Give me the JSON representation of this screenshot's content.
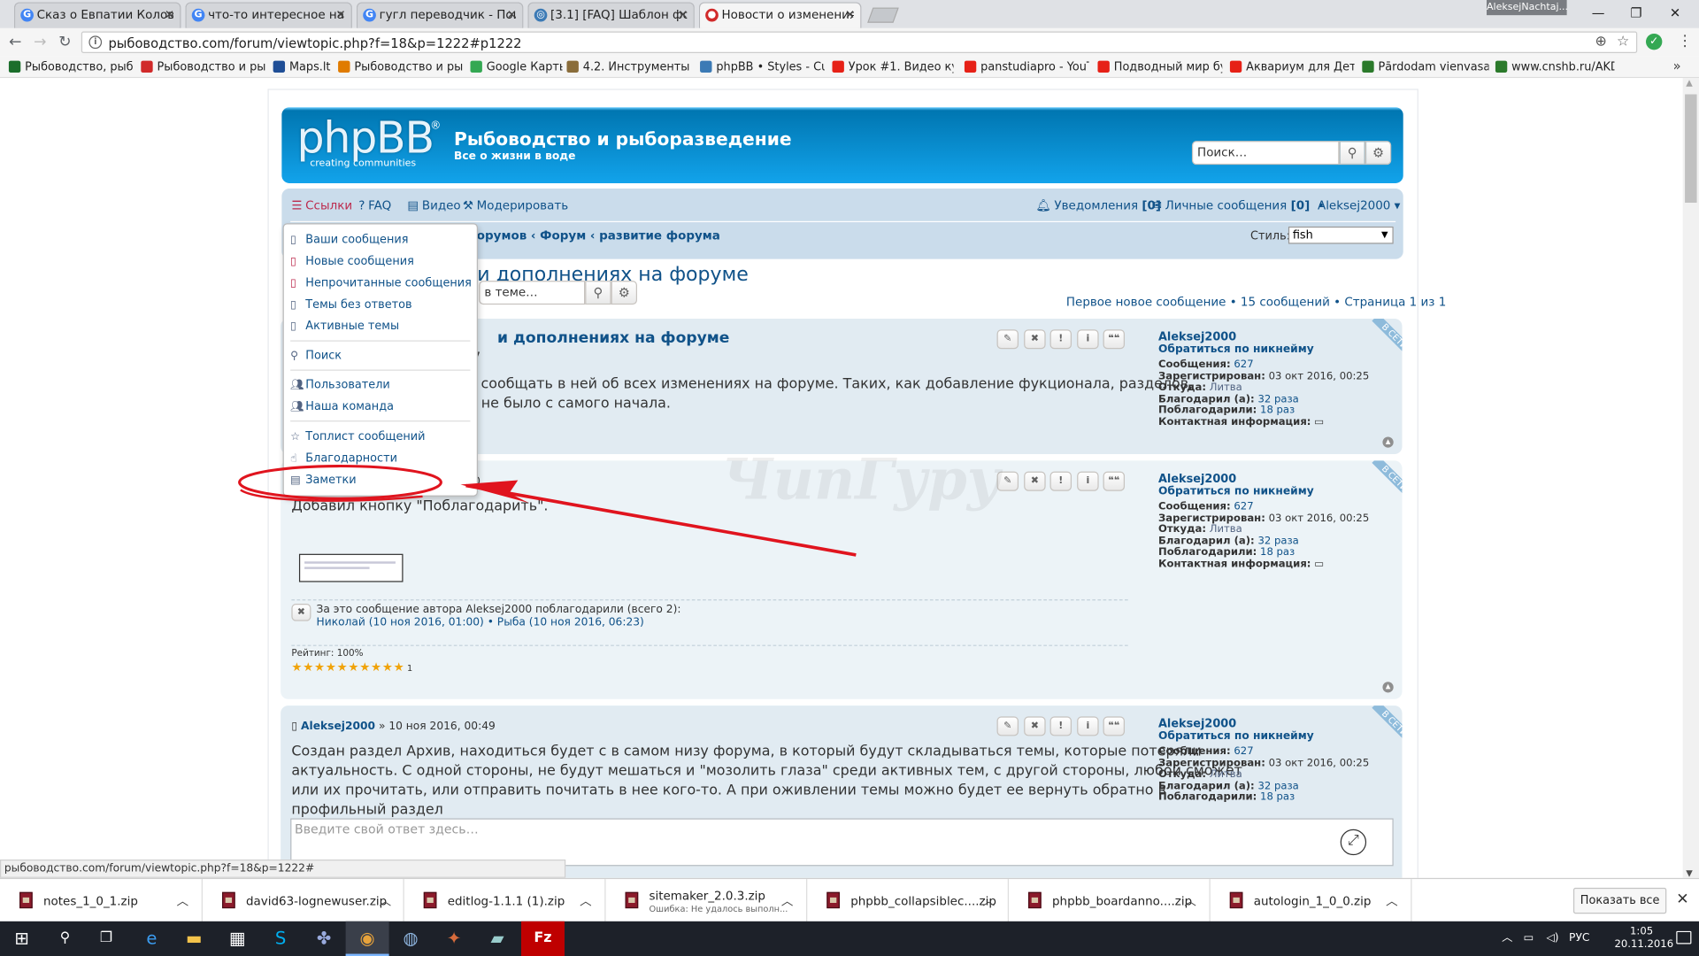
{
  "browser": {
    "tabs": [
      {
        "title": "Сказ о Евпатии Коловр",
        "icon_color": "#4285f4",
        "icon": "google-icon"
      },
      {
        "title": "что-то интересное нап",
        "icon_color": "#4285f4",
        "icon": "google-icon"
      },
      {
        "title": "гугл переводчик - Поис",
        "icon_color": "#4285f4",
        "icon": "google-icon"
      },
      {
        "title": "[3.1] [FAQ] Шаблон фор",
        "icon_color": "#3c7ab5",
        "icon": "phpbb-icon"
      },
      {
        "title": "Новости о изменениях",
        "icon_color": "#d12a2a",
        "icon": "forum-icon",
        "active": true
      }
    ],
    "user_badge": "AleksejNachtaj...",
    "url": "рыбоводство.com/forum/viewtopic.php?f=18&p=1222#p1222",
    "bookmarks": [
      {
        "label": "Рыбоводство, рыбор",
        "color": "#1b6e2b"
      },
      {
        "label": "Рыбоводство и рыбс",
        "color": "#d12a2a"
      },
      {
        "label": "Maps.lt",
        "color": "#1f4e96"
      },
      {
        "label": "Рыбоводство и рыбс",
        "color": "#e07b00"
      },
      {
        "label": "Google Карты",
        "color": "#34a853"
      },
      {
        "label": "4.2. Инструменты мо",
        "color": "#8a6d3b"
      },
      {
        "label": "phpBB • Styles - Custo",
        "color": "#3c7ab5"
      },
      {
        "label": "Урок #1. Видео курс",
        "color": "#e62117"
      },
      {
        "label": "panstudiapro - YouTu",
        "color": "#e62117"
      },
      {
        "label": "Подводный мир бух",
        "color": "#e62117"
      },
      {
        "label": "Аквариум для Детей",
        "color": "#e62117"
      },
      {
        "label": "Pārdodam vienvasara",
        "color": "#2b7a2b"
      },
      {
        "label": "www.cnshb.ru/AKDiL/",
        "color": "#2b7a2b"
      }
    ]
  },
  "site": {
    "logo_text": "phpBB",
    "logo_sub": "creating     communities",
    "title": "Рыбоводство и рыборазведение",
    "description": "Все о жизни в воде",
    "search_placeholder": "Поиск…"
  },
  "nav": {
    "links": "Ссылки",
    "faq": "FAQ",
    "video": "Видео",
    "moderate": "Модерировать",
    "notifications": "Уведомления",
    "notifications_count": "[0]",
    "pm": "Личные сообщения",
    "pm_count": "[0]",
    "user": "Aleksej2000 ▾",
    "crumbs": "орумов  ‹  Форум  ‹  развитие форума",
    "style_label": "Стиль:",
    "style_value": "fish"
  },
  "dropdown": {
    "items": [
      {
        "label": "Ваши сообщения",
        "icon": "doc-icon"
      },
      {
        "label": "Новые сообщения",
        "icon": "doc-red-icon"
      },
      {
        "label": "Непрочитанные сообщения",
        "icon": "doc-red-icon"
      },
      {
        "label": "Темы без ответов",
        "icon": "doc-icon"
      },
      {
        "label": "Активные темы",
        "icon": "doc-icon"
      },
      {
        "label": "Поиск",
        "icon": "search-icon"
      },
      {
        "label": "Пользователи",
        "icon": "users-icon"
      },
      {
        "label": "Наша команда",
        "icon": "team-icon"
      },
      {
        "label": "Топлист сообщений",
        "icon": "star-icon"
      },
      {
        "label": "Благодарности",
        "icon": "thanks-icon"
      },
      {
        "label": "Заметки",
        "icon": "notes-icon"
      }
    ]
  },
  "topic": {
    "title": "х и дополнениях на форуме",
    "search_placeholder": "в теме…",
    "pagination": "Первое новое сообщение • 15 сообщений • Страница 1 из 1"
  },
  "posts": [
    {
      "title": "и дополнениях на форуме",
      "meta": "7",
      "lines": [
        "у сообщать в ней об всех изменениях на форуме. Таких, как добавление фукционала, разделов,",
        "о не было с самого начала."
      ]
    },
    {
      "meta": "0",
      "lines": [
        "Добавил кнопку \"Поблагодарить\"."
      ],
      "thanks_line1": "За это сообщение автора Aleksej2000 поблагодарили (всего 2):",
      "thanks_line2": "Николай (10 ноя 2016, 01:00) • Рыба (10 ноя 2016, 06:23)",
      "rating": "Рейтинг: 100%",
      "stars": "★★★★★★★★★★",
      "stars_count": "1"
    },
    {
      "author": "Aleksej2000",
      "date": "» 10 ноя 2016, 00:49",
      "lines": [
        "Создан раздел Архив, находиться будет с в самом низу форума, в который будут складываться темы, которые потеряли",
        "актуальность. С одной стороны, не будут мешаться и \"мозолить глаза\" среди активных тем, с другой стороны, любой сможет",
        "или их прочитать, или отправить почитать в нее кого-то. А при оживлении темы можно будет ее вернуть обратно в",
        "профильный раздел"
      ]
    }
  ],
  "profile": {
    "username": "Aleksej2000",
    "contact_by_nick": "Обратиться по никнейму",
    "posts_label": "Сообщения:",
    "posts": "627",
    "registered_label": "Зарегистрирован:",
    "registered": "03 окт 2016, 00:25",
    "from_label": "Откуда:",
    "from": "Литва",
    "thanked_label": "Благодарил (а):",
    "thanked": "32 раза",
    "got_thanks_label": "Поблагодарили:",
    "got_thanks": "18 раз",
    "contact_label": "Контактная информация:",
    "online_badge": "В СЕТИ"
  },
  "post_buttons": [
    "✎",
    "✖",
    "!",
    "i",
    "❝❝"
  ],
  "watermark": "ЧипГуру",
  "reply_placeholder": "Введите свой ответ здесь…",
  "status_url": "рыбоводство.com/forum/viewtopic.php?f=18&p=1222#",
  "downloads": [
    {
      "name": "notes_1_0_1.zip"
    },
    {
      "name": "david63-lognewuser.zip"
    },
    {
      "name": "editlog-1.1.1 (1).zip"
    },
    {
      "name": "sitemaker_2.0.3.zip",
      "sub": "Ошибка: Не удалось выполн..."
    },
    {
      "name": "phpbb_collapsiblec....zip"
    },
    {
      "name": "phpbb_boardanno....zip"
    },
    {
      "name": "autologin_1_0_0.zip"
    }
  ],
  "show_all": "Показать все",
  "taskbar": {
    "lang": "РУС",
    "time": "1:05",
    "date": "20.11.2016"
  },
  "annotation_color": "#e0141e"
}
